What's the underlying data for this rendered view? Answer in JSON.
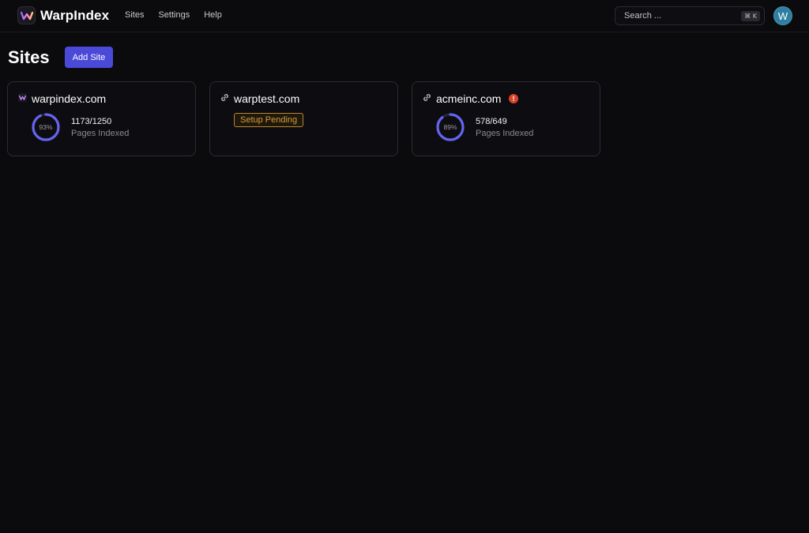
{
  "app": {
    "name": "WarpIndex"
  },
  "nav": [
    {
      "label": "Sites"
    },
    {
      "label": "Settings"
    },
    {
      "label": "Help"
    }
  ],
  "search": {
    "placeholder": "Search ...",
    "shortcut": "⌘ K"
  },
  "user": {
    "avatar_initial": "W",
    "avatar_color": "#2f7fa1"
  },
  "page": {
    "title": "Sites",
    "add_button": "Add Site"
  },
  "colors": {
    "accent": "#4b4ad8",
    "ring": "#6464f0",
    "warning": "#d99c39",
    "error": "#d8432a"
  },
  "sites": [
    {
      "domain": "warpindex.com",
      "icon": "warpindex-logo-icon",
      "status": "indexed",
      "percent_label": "93%",
      "progress": 0.93,
      "count": "1173/1250",
      "count_label": "Pages Indexed"
    },
    {
      "domain": "warptest.com",
      "icon": "link-icon",
      "status": "pending",
      "status_label": "Setup Pending"
    },
    {
      "domain": "acmeinc.com",
      "icon": "link-icon",
      "status": "indexed",
      "alert": "!",
      "percent_label": "89%",
      "progress": 0.89,
      "count": "578/649",
      "count_label": "Pages Indexed"
    }
  ]
}
